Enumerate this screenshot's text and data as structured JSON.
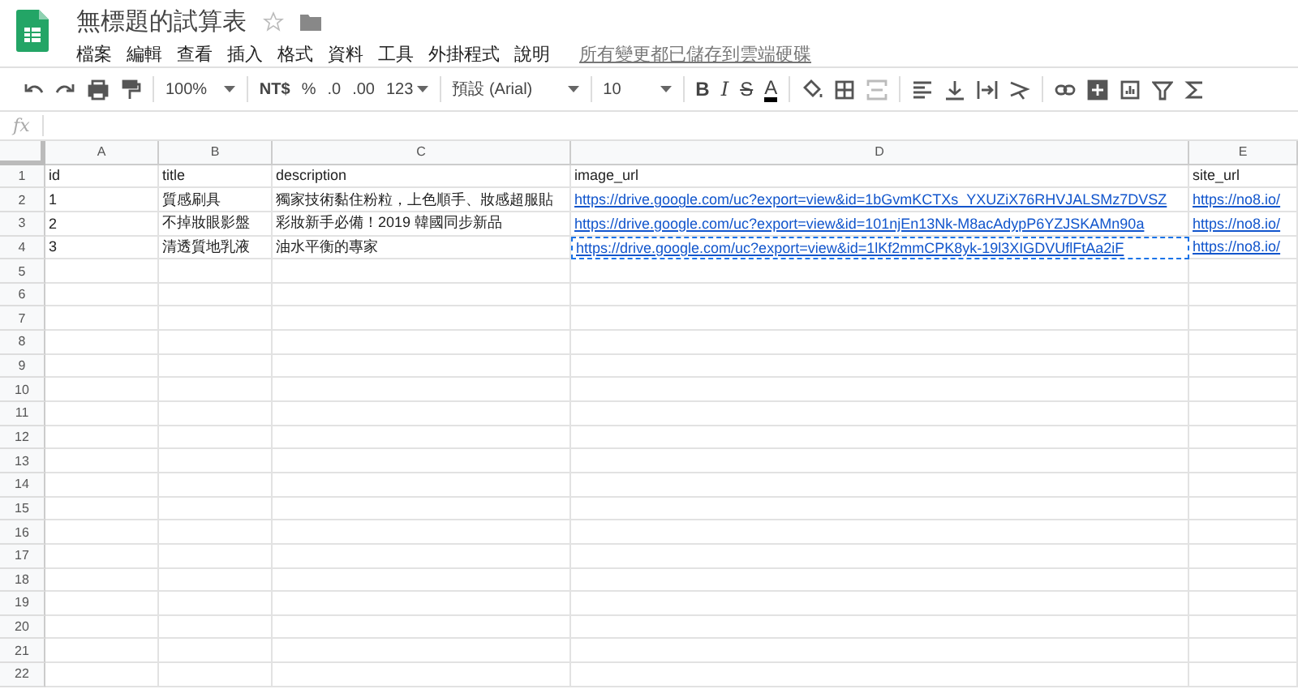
{
  "header": {
    "title": "無標題的試算表",
    "starred": false,
    "menus": [
      "檔案",
      "編輯",
      "查看",
      "插入",
      "格式",
      "資料",
      "工具",
      "外掛程式",
      "說明"
    ],
    "save_status": "所有變更都已儲存到雲端硬碟"
  },
  "toolbar": {
    "zoom": "100%",
    "currency": "NT$",
    "percent": "%",
    "decrease_decimals": ".0",
    "increase_decimals": ".00",
    "number_format": "123",
    "font": "預設 (Arial)",
    "font_size": "10",
    "bold": "B",
    "italic": "I",
    "strikethrough": "S",
    "text_color": "A"
  },
  "formula_bar": {
    "label": "fx"
  },
  "sheet": {
    "columns": [
      "A",
      "B",
      "C",
      "D",
      "E"
    ],
    "rows": [
      {
        "number": "1",
        "cells": [
          {
            "kind": "text",
            "text": "id"
          },
          {
            "kind": "text",
            "text": "title"
          },
          {
            "kind": "text",
            "text": "description"
          },
          {
            "kind": "text",
            "text": "image_url"
          },
          {
            "kind": "text",
            "text": "site_url"
          }
        ]
      },
      {
        "number": "2",
        "cells": [
          {
            "kind": "text",
            "text": "1"
          },
          {
            "kind": "text",
            "text": "質感刷具"
          },
          {
            "kind": "text",
            "text": "獨家技術黏住粉粒，上色順手、妝感超服貼"
          },
          {
            "kind": "link",
            "text": "https://drive.google.com/uc?export=view&id=1bGvmKCTXs_YXUZiX76RHVJALSMz7DVSZ"
          },
          {
            "kind": "link",
            "text": "https://no8.io/"
          }
        ]
      },
      {
        "number": "3",
        "cells": [
          {
            "kind": "text",
            "text": "2"
          },
          {
            "kind": "text",
            "text": "不掉妝眼影盤"
          },
          {
            "kind": "text",
            "text": "彩妝新手必備！2019 韓國同步新品"
          },
          {
            "kind": "link",
            "text": "https://drive.google.com/uc?export=view&id=101njEn13Nk-M8acAdypP6YZJSKAMn90a"
          },
          {
            "kind": "link",
            "text": "https://no8.io/"
          }
        ]
      },
      {
        "number": "4",
        "cells": [
          {
            "kind": "text",
            "text": "3"
          },
          {
            "kind": "text",
            "text": "清透質地乳液"
          },
          {
            "kind": "text",
            "text": "油水平衡的專家"
          },
          {
            "kind": "link",
            "text": "https://drive.google.com/uc?export=view&id=1lKf2mmCPK8yk-19l3XIGDVUflFtAa2iF",
            "copied": true
          },
          {
            "kind": "link",
            "text": "https://no8.io/"
          }
        ]
      },
      {
        "number": "5"
      },
      {
        "number": "6"
      },
      {
        "number": "7"
      },
      {
        "number": "8"
      },
      {
        "number": "9"
      },
      {
        "number": "10"
      },
      {
        "number": "11"
      },
      {
        "number": "12"
      },
      {
        "number": "13"
      },
      {
        "number": "14"
      },
      {
        "number": "15"
      },
      {
        "number": "16"
      },
      {
        "number": "17"
      },
      {
        "number": "18"
      },
      {
        "number": "19"
      },
      {
        "number": "20"
      },
      {
        "number": "21"
      },
      {
        "number": "22"
      }
    ]
  }
}
